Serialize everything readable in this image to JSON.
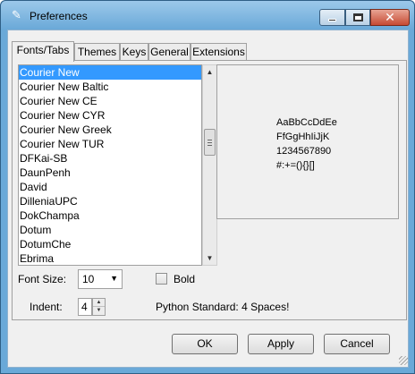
{
  "window": {
    "title": "Preferences",
    "icon": "feather-icon"
  },
  "tabs": [
    {
      "label": "Fonts/Tabs",
      "active": true
    },
    {
      "label": "Themes",
      "active": false
    },
    {
      "label": "Keys",
      "active": false
    },
    {
      "label": "General",
      "active": false
    },
    {
      "label": "Extensions",
      "active": false
    }
  ],
  "font_list": {
    "selected": "Courier New",
    "items": [
      "Courier New",
      "Courier New Baltic",
      "Courier New CE",
      "Courier New CYR",
      "Courier New Greek",
      "Courier New TUR",
      "DFKai-SB",
      "DaunPenh",
      "David",
      "DilleniaUPC",
      "DokChampa",
      "Dotum",
      "DotumChe",
      "Ebrima"
    ]
  },
  "sample": {
    "lines": [
      "AaBbCcDdEe",
      "FfGgHhIiJjK",
      "1234567890",
      "#:+=(){}[]"
    ]
  },
  "font_size": {
    "label": "Font Size:",
    "value": "10"
  },
  "bold": {
    "label": "Bold",
    "checked": false
  },
  "indent": {
    "label": "Indent:",
    "value": "4",
    "note": "Python Standard: 4 Spaces!"
  },
  "buttons": {
    "ok": "OK",
    "apply": "Apply",
    "cancel": "Cancel"
  },
  "colors": {
    "selection": "#3399ff",
    "titlebar": "#6aa9d8",
    "close_button": "#c64a33"
  }
}
